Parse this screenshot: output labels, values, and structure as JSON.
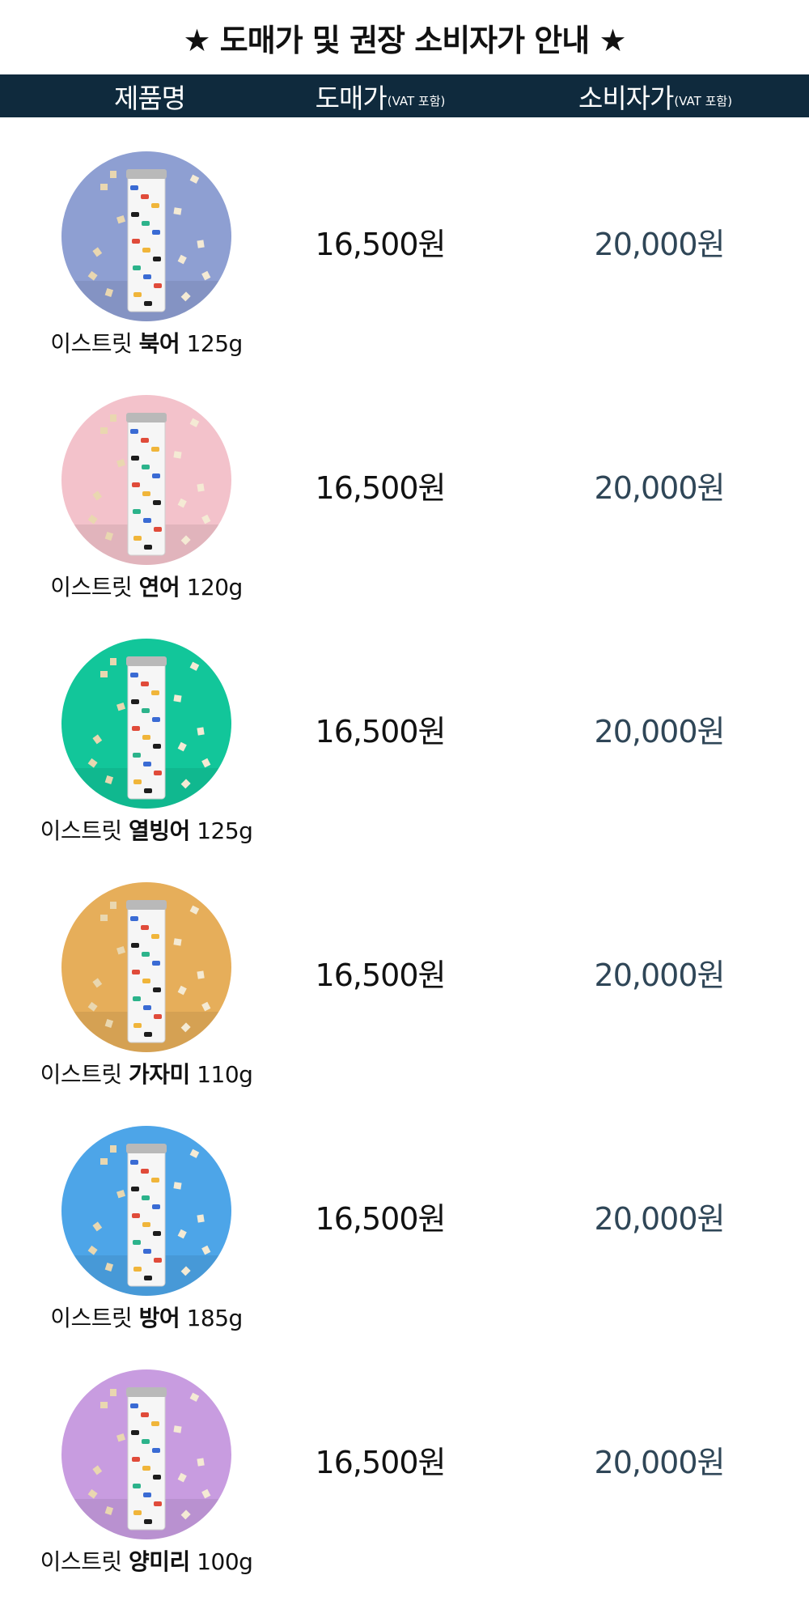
{
  "title": "★ 도매가 및 권장 소비자가 안내 ★",
  "header": {
    "product_label": "제품명",
    "wholesale_label": "도매가",
    "wholesale_note": "(VAT 포함)",
    "retail_label": "소비자가",
    "retail_note": "(VAT 포함)"
  },
  "colors": {
    "header_bg": "#0f2a3d",
    "retail_price": "#2f4657"
  },
  "products": [
    {
      "brand": "이스트릿",
      "name": "북어",
      "weight": "125g",
      "wholesale_price": "16,500원",
      "retail_price": "20,000원",
      "image_bg": "#8e9fd2",
      "image_name": "pollack-can-image"
    },
    {
      "brand": "이스트릿",
      "name": "연어",
      "weight": "120g",
      "wholesale_price": "16,500원",
      "retail_price": "20,000원",
      "image_bg": "#f3c2cb",
      "image_name": "salmon-can-image"
    },
    {
      "brand": "이스트릿",
      "name": "열빙어",
      "weight": "125g",
      "wholesale_price": "16,500원",
      "retail_price": "20,000원",
      "image_bg": "#12c69a",
      "image_name": "capelin-can-image"
    },
    {
      "brand": "이스트릿",
      "name": "가자미",
      "weight": "110g",
      "wholesale_price": "16,500원",
      "retail_price": "20,000원",
      "image_bg": "#e6ae5a",
      "image_name": "flounder-can-image"
    },
    {
      "brand": "이스트릿",
      "name": "방어",
      "weight": "185g",
      "wholesale_price": "16,500원",
      "retail_price": "20,000원",
      "image_bg": "#4da5e8",
      "image_name": "yellowtail-can-image"
    },
    {
      "brand": "이스트릿",
      "name": "양미리",
      "weight": "100g",
      "wholesale_price": "16,500원",
      "retail_price": "20,000원",
      "image_bg": "#c89ce0",
      "image_name": "sand-lance-can-image"
    }
  ]
}
